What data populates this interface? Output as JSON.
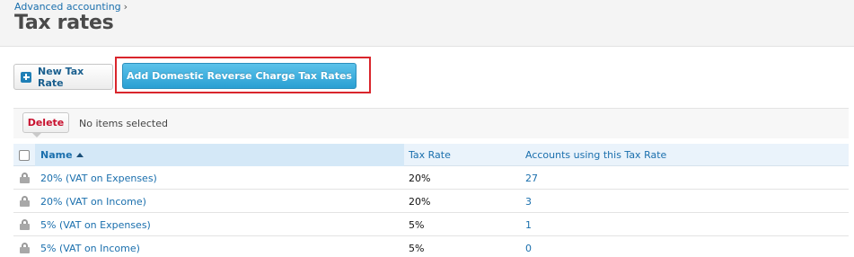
{
  "header": {
    "breadcrumb": "Advanced accounting",
    "breadcrumb_sep": "›",
    "title": "Tax rates"
  },
  "actions": {
    "new_tax_rate": "New Tax Rate",
    "add_reverse_charge": "Add Domestic Reverse Charge Tax Rates"
  },
  "toolbar": {
    "delete_label": "Delete",
    "selection_status": "No items selected"
  },
  "table": {
    "columns": {
      "name": "Name",
      "tax_rate": "Tax Rate",
      "accounts": "Accounts using this Tax Rate"
    },
    "sort": "ascending",
    "rows": [
      {
        "name": "20% (VAT on Expenses)",
        "tax_rate": "20%",
        "accounts": "27"
      },
      {
        "name": "20% (VAT on Income)",
        "tax_rate": "20%",
        "accounts": "3"
      },
      {
        "name": "5% (VAT on Expenses)",
        "tax_rate": "5%",
        "accounts": "1"
      },
      {
        "name": "5% (VAT on Income)",
        "tax_rate": "5%",
        "accounts": "0"
      }
    ]
  },
  "icons": {
    "new": "plus-icon",
    "row": "lock-icon",
    "sort": "sort-up-icon"
  },
  "colors": {
    "link": "#1a6fad",
    "primary_button": "#2a9fd3",
    "delete": "#c8102e",
    "highlight": "#d9252c"
  }
}
